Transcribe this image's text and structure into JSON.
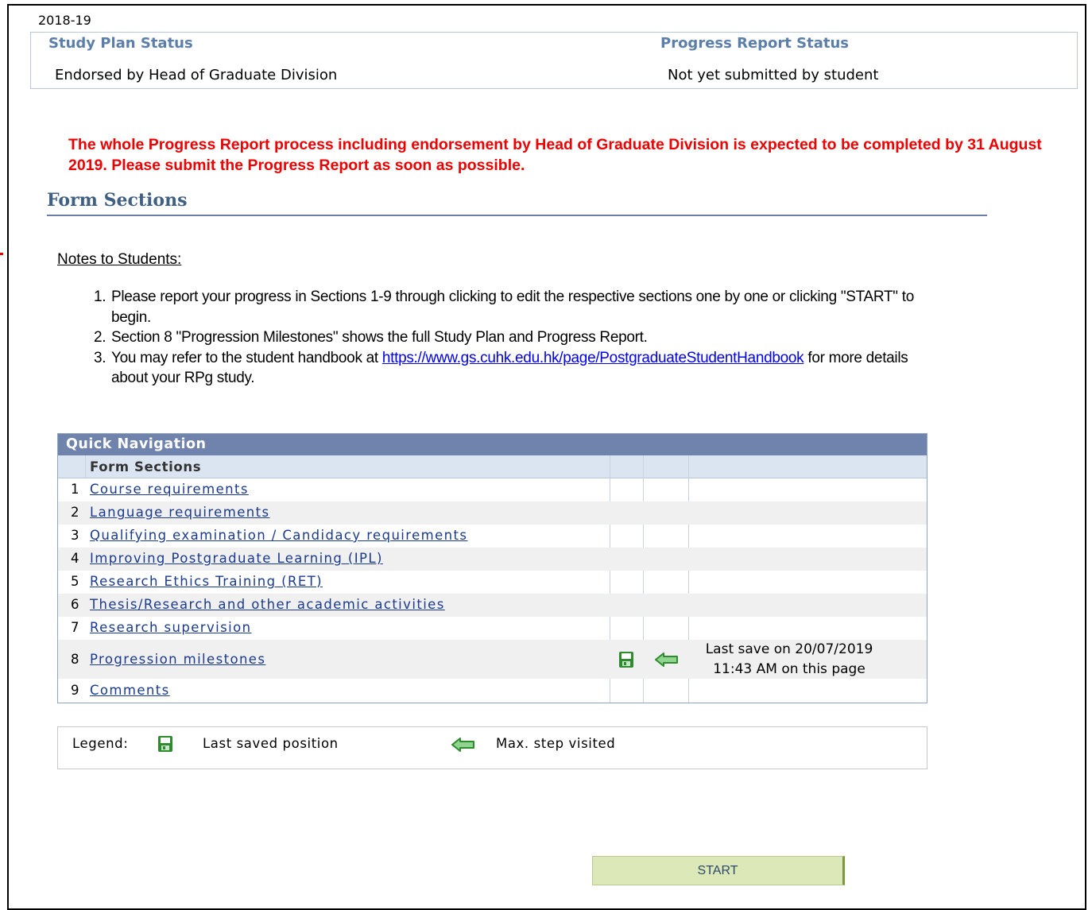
{
  "year": "2018-19",
  "status": {
    "study_plan_label": "Study Plan Status",
    "study_plan_value": "Endorsed by Head of Graduate Division",
    "progress_label": "Progress Report Status",
    "progress_value": "Not yet submitted by student"
  },
  "warning": "The whole Progress Report process including endorsement by Head of Graduate Division is expected to be completed by 31 August 2019. Please submit the Progress Report as soon as possible.",
  "form_sections_title": "Form Sections",
  "notes": {
    "title": "Notes to Students:",
    "items": [
      {
        "num": "1.",
        "text": "Please report your progress in Sections 1-9 through clicking to edit the respective sections one by one or clicking \"START\" to begin."
      },
      {
        "num": "2.",
        "text": "Section 8 \"Progression Milestones\" shows the full Study Plan and Progress Report."
      },
      {
        "num": "3.",
        "before": "You may refer to the student handbook at ",
        "link": "https://www.gs.cuhk.edu.hk/page/PostgraduateStudentHandbook",
        "after": " for more details about your RPg study."
      }
    ]
  },
  "quick_nav": {
    "title": "Quick Navigation",
    "column_header": "Form Sections",
    "rows": [
      {
        "num": "1",
        "label": "Course requirements"
      },
      {
        "num": "2",
        "label": "Language requirements"
      },
      {
        "num": "3",
        "label": "Qualifying examination / Candidacy requirements"
      },
      {
        "num": "4",
        "label": "Improving Postgraduate Learning (IPL)"
      },
      {
        "num": "5",
        "label": "Research Ethics Training (RET)"
      },
      {
        "num": "6",
        "label": "Thesis/Research and other academic activities"
      },
      {
        "num": "7",
        "label": "Research supervision"
      },
      {
        "num": "8",
        "label": "Progression milestones",
        "icons": [
          "save-icon",
          "arrow-left-icon"
        ],
        "last_save_line1": "Last save on 20/07/2019",
        "last_save_line2": "11:43 AM on this page"
      },
      {
        "num": "9",
        "label": "Comments"
      }
    ]
  },
  "legend": {
    "label": "Legend:",
    "saved": "Last saved position",
    "max_step": "Max. step visited"
  },
  "start_button": "START",
  "colors": {
    "warning": "#ee0000",
    "header_bar": "#6f83ad",
    "start_bg": "#dde8b8",
    "icon_green": "#2e8b2e"
  }
}
